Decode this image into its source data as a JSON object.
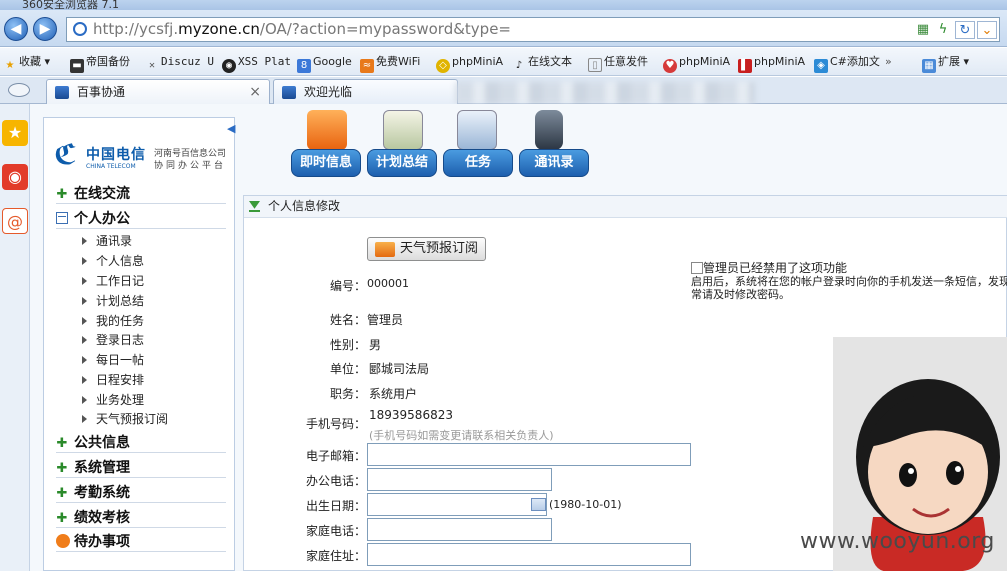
{
  "window": {
    "title": "360安全浏览器 7.1"
  },
  "address": {
    "url_prefix": "http://ycsfj.",
    "url_domain": "myzone.cn",
    "url_suffix": "/OA/?action=mypassword&type=",
    "icons": [
      "qr-icon",
      "lightning-icon",
      "reload-icon",
      "chevron-down-icon"
    ]
  },
  "bookmarks": {
    "items": [
      {
        "label": "收藏",
        "icon": "star-icon"
      },
      {
        "label": "帝国备份",
        "icon": "doc-icon"
      },
      {
        "label": "Discuz U",
        "icon": "x-icon"
      },
      {
        "label": "XSS Plat",
        "icon": "shield-icon"
      },
      {
        "label": "Google",
        "icon": "google-icon"
      },
      {
        "label": "免费WiFi",
        "icon": "wifi-icon"
      },
      {
        "label": "phpMiniA",
        "icon": "php-icon"
      },
      {
        "label": "在线文本",
        "icon": "text-icon"
      },
      {
        "label": "任意发件",
        "icon": "page-icon"
      },
      {
        "label": "phpMiniA",
        "icon": "php-icon"
      },
      {
        "label": "phpMiniA",
        "icon": "php-icon"
      },
      {
        "label": "C#添加文",
        "icon": "csharp-icon"
      }
    ],
    "more": "»",
    "ext_label": "扩展"
  },
  "tabs": [
    {
      "label": "百事协通"
    },
    {
      "label": "欢迎光临"
    }
  ],
  "sidebar": {
    "logo": {
      "cn": "中国电信",
      "en": "CHINA TELECOM",
      "sub1": "河南号百信息公司",
      "sub2": "协同办公平台"
    },
    "sections": [
      {
        "label": "在线交流"
      },
      {
        "label": "个人办公"
      },
      {
        "label": "公共信息"
      },
      {
        "label": "系统管理"
      },
      {
        "label": "考勤系统"
      },
      {
        "label": "绩效考核"
      },
      {
        "label": "待办事项"
      }
    ],
    "items": [
      "通讯录",
      "个人信息",
      "工作日记",
      "计划总结",
      "我的任务",
      "登录日志",
      "每日一帖",
      "日程安排",
      "业务处理",
      "天气预报订阅"
    ]
  },
  "toolbar": [
    {
      "label": "即时信息"
    },
    {
      "label": "计划总结"
    },
    {
      "label": "任务"
    },
    {
      "label": "通讯录"
    }
  ],
  "content": {
    "breadcrumb": "个人信息修改",
    "weather_button": "天气预报订阅",
    "notice_title": "管理员已经禁用了这项功能",
    "notice_text": "启用后，系统将在您的帐户登录时向你的手机发送一条短信，发现异常请及时修改密码。",
    "fields": {
      "id_label": "编号：",
      "id_value": "000001",
      "name_label": "姓名：",
      "name_value": "管理员",
      "gender_label": "性别：",
      "gender_value": "男",
      "unit_label": "单位：",
      "unit_value": "郾城司法局",
      "title_label": "职务：",
      "title_value": "系统用户",
      "phone_label": "手机号码：",
      "phone_value": "18939586823",
      "phone_hint": "(手机号码如需变更请联系相关负责人)",
      "email_label": "电子邮箱：",
      "office_label": "办公电话：",
      "birth_label": "出生日期：",
      "birth_hint": "(1980-10-01)",
      "home_phone_label": "家庭电话：",
      "home_addr_label": "家庭住址："
    }
  },
  "watermark": "www.wooyun.org"
}
